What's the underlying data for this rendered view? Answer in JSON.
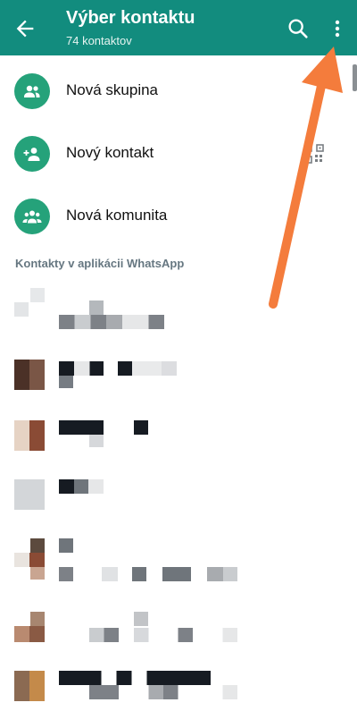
{
  "appbar": {
    "title": "Výber kontaktu",
    "subtitle": "74 kontaktov",
    "back_icon": "arrow-left-icon",
    "search_icon": "search-icon",
    "more_icon": "more-vertical-icon",
    "color": "#128c7e"
  },
  "actions": [
    {
      "label": "Nová skupina",
      "icon": "group-icon"
    },
    {
      "label": "Nový kontakt",
      "icon": "add-person-icon",
      "trailing_icon": "qr-code-icon"
    },
    {
      "label": "Nová komunita",
      "icon": "community-icon"
    }
  ],
  "section_header": "Kontakty v aplikácii WhatsApp",
  "accent_color": "#25a27a",
  "annotation_color": "#f47c3c"
}
